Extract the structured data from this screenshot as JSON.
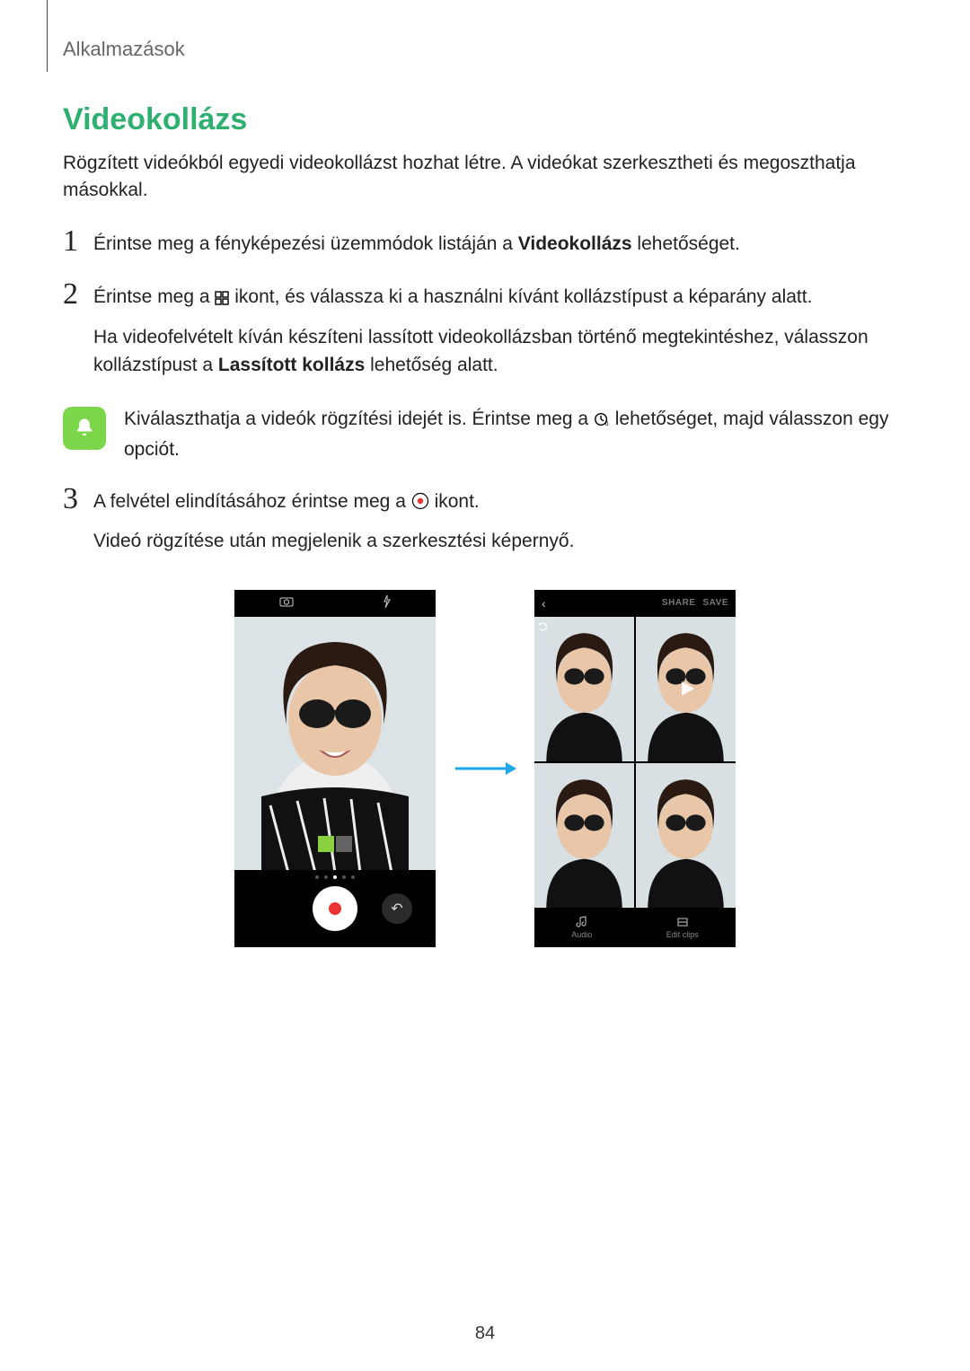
{
  "header": "Alkalmazások",
  "title": "Videokollázs",
  "intro": "Rögzített videókból egyedi videokollázst hozhat létre. A videókat szerkesztheti és megoszthatja másokkal.",
  "steps": {
    "s1": {
      "num": "1",
      "text_a": "Érintse meg a fényképezési üzemmódok listáján a ",
      "text_bold": "Videokollázs",
      "text_b": " lehetőséget."
    },
    "s2": {
      "num": "2",
      "line1_a": "Érintse meg a ",
      "line1_b": " ikont, és válassza ki a használni kívánt kollázstípust a képarány alatt.",
      "line2_a": "Ha videofelvételt kíván készíteni lassított videokollázsban történő megtekintéshez, válasszon kollázstípust a ",
      "line2_bold": "Lassított kollázs",
      "line2_b": " lehetőség alatt."
    },
    "note": {
      "text_a": "Kiválaszthatja a videók rögzítési idejét is. Érintse meg a ",
      "text_b": " lehetőséget, majd válasszon egy opciót."
    },
    "s3": {
      "num": "3",
      "line1_a": "A felvétel elindításához érintse meg a ",
      "line1_b": " ikont.",
      "line2": "Videó rögzítése után megjelenik a szerkesztési képernyő."
    }
  },
  "phone_b": {
    "share": "SHARE",
    "save": "SAVE",
    "audio": "Audio",
    "edit": "Edit clips"
  },
  "page_number": "84"
}
